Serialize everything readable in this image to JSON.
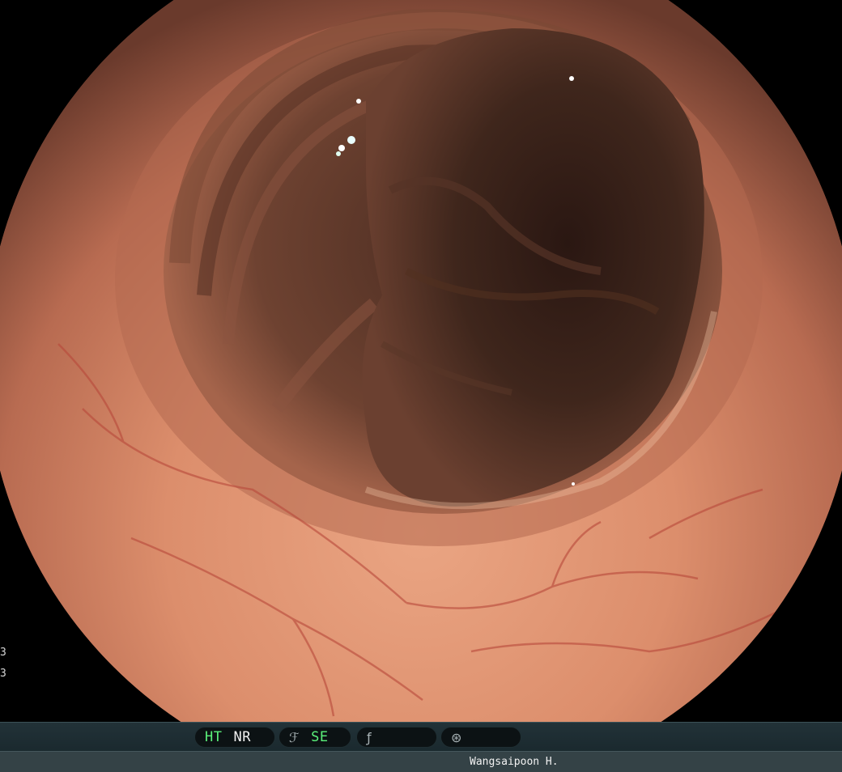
{
  "scene": {
    "description_image": "endoscopy-lumen",
    "colors": {
      "mucosa": "#d98b68",
      "lumen_dark": "#3a2319",
      "vessel": "#b8483a",
      "bar": "#1a292e",
      "indicator_green": "#5bf07a"
    }
  },
  "left_marks": [
    "3",
    "3"
  ],
  "status": {
    "pill1": {
      "ht": "HT",
      "nr": "NR"
    },
    "pill2": {
      "icon": "enhancement-icon",
      "glyph": "ℱ",
      "se": "SE"
    },
    "pill3": {
      "icon": "function-icon",
      "glyph": "ƒ"
    },
    "pill4": {
      "icon": "waveform-icon",
      "glyph": "⊛"
    }
  },
  "footer": {
    "operator": "Wangsaipoon H."
  }
}
